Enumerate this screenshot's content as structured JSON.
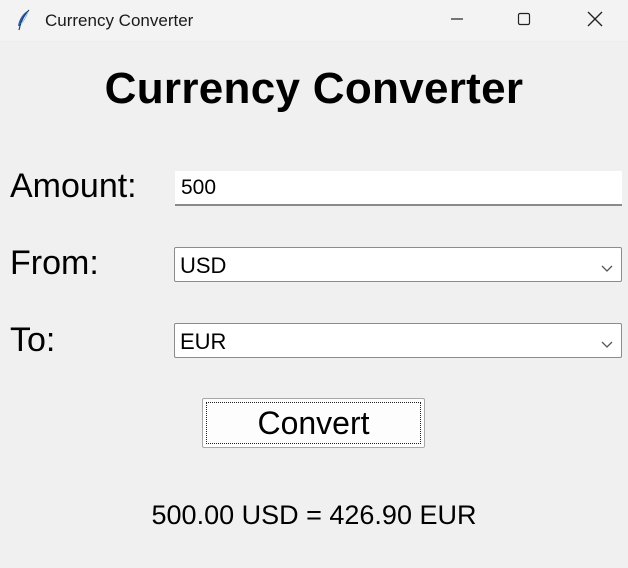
{
  "window": {
    "title": "Currency Converter",
    "icon": "feather-icon",
    "controls": [
      "minimize-icon",
      "maximize-icon",
      "close-icon"
    ]
  },
  "main": {
    "heading": "Currency Converter",
    "amount_label": "Amount:",
    "amount_value": "500",
    "from_label": "From:",
    "from_value": "USD",
    "to_label": "To:",
    "to_value": "EUR",
    "convert_label": "Convert",
    "result_text": "500.00 USD = 426.90 EUR"
  },
  "colors": {
    "background": "#f0f0f0",
    "field_background": "#ffffff",
    "text": "#000000"
  }
}
